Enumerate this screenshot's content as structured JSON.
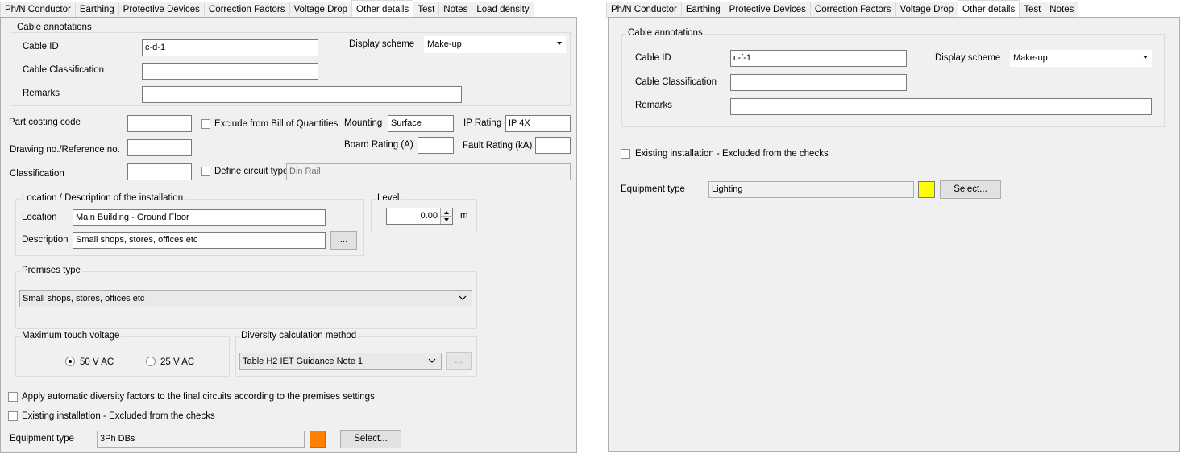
{
  "left": {
    "tabs": [
      "Ph/N Conductor",
      "Earthing",
      "Protective Devices",
      "Correction Factors",
      "Voltage Drop",
      "Other details",
      "Test",
      "Notes",
      "Load density"
    ],
    "cable_annotations": {
      "legend": "Cable annotations",
      "cable_id_label": "Cable ID",
      "cable_id_value": "c-d-1",
      "classification_label": "Cable Classification",
      "classification_value": "",
      "remarks_label": "Remarks",
      "remarks_value": "",
      "display_scheme_label": "Display scheme",
      "display_scheme_value": "Make-up"
    },
    "part_costing_label": "Part costing code",
    "drawing_label": "Drawing no./Reference no.",
    "classification_label": "Classification",
    "exclude_boq_label": "Exclude from Bill of Quantities",
    "define_circuit_label": "Define circuit type",
    "define_circuit_value": "Din Rail",
    "mounting_label": "Mounting",
    "mounting_value": "Surface",
    "ip_rating_label": "IP Rating",
    "ip_rating_value": "IP 4X",
    "board_rating_label": "Board Rating (A)",
    "fault_rating_label": "Fault Rating (kA)",
    "location_group": {
      "legend": "Location / Description of the installation",
      "location_label": "Location",
      "location_value": "Main Building - Ground Floor",
      "description_label": "Description",
      "description_value": "Small shops, stores, offices etc",
      "ellipsis": "..."
    },
    "level": {
      "legend": "Level",
      "value": "0.00",
      "unit": "m"
    },
    "premises": {
      "legend": "Premises type",
      "value": "Small shops, stores, offices etc"
    },
    "touch_voltage": {
      "legend": "Maximum touch voltage",
      "opt1": "50 V AC",
      "opt2": "25 V AC"
    },
    "diversity": {
      "legend": "Diversity calculation method",
      "value": "Table H2 IET Guidance Note 1",
      "button": "..."
    },
    "apply_diversity_label": "Apply automatic diversity factors to the final circuits according to the premises settings",
    "existing_label": "Existing installation - Excluded from the checks",
    "equipment_label": "Equipment type",
    "equipment_value": "3Ph DBs",
    "select_button": "Select...",
    "swatch_color": "#ff8000"
  },
  "right": {
    "tabs": [
      "Ph/N Conductor",
      "Earthing",
      "Protective Devices",
      "Correction Factors",
      "Voltage Drop",
      "Other details",
      "Test",
      "Notes"
    ],
    "cable_annotations": {
      "legend": "Cable annotations",
      "cable_id_label": "Cable ID",
      "cable_id_value": "c-f-1",
      "classification_label": "Cable Classification",
      "classification_value": "",
      "remarks_label": "Remarks",
      "remarks_value": "",
      "display_scheme_label": "Display scheme",
      "display_scheme_value": "Make-up"
    },
    "existing_label": "Existing installation - Excluded from the checks",
    "equipment_label": "Equipment type",
    "equipment_value": "Lighting",
    "select_button": "Select...",
    "swatch_color": "#ffff00"
  }
}
